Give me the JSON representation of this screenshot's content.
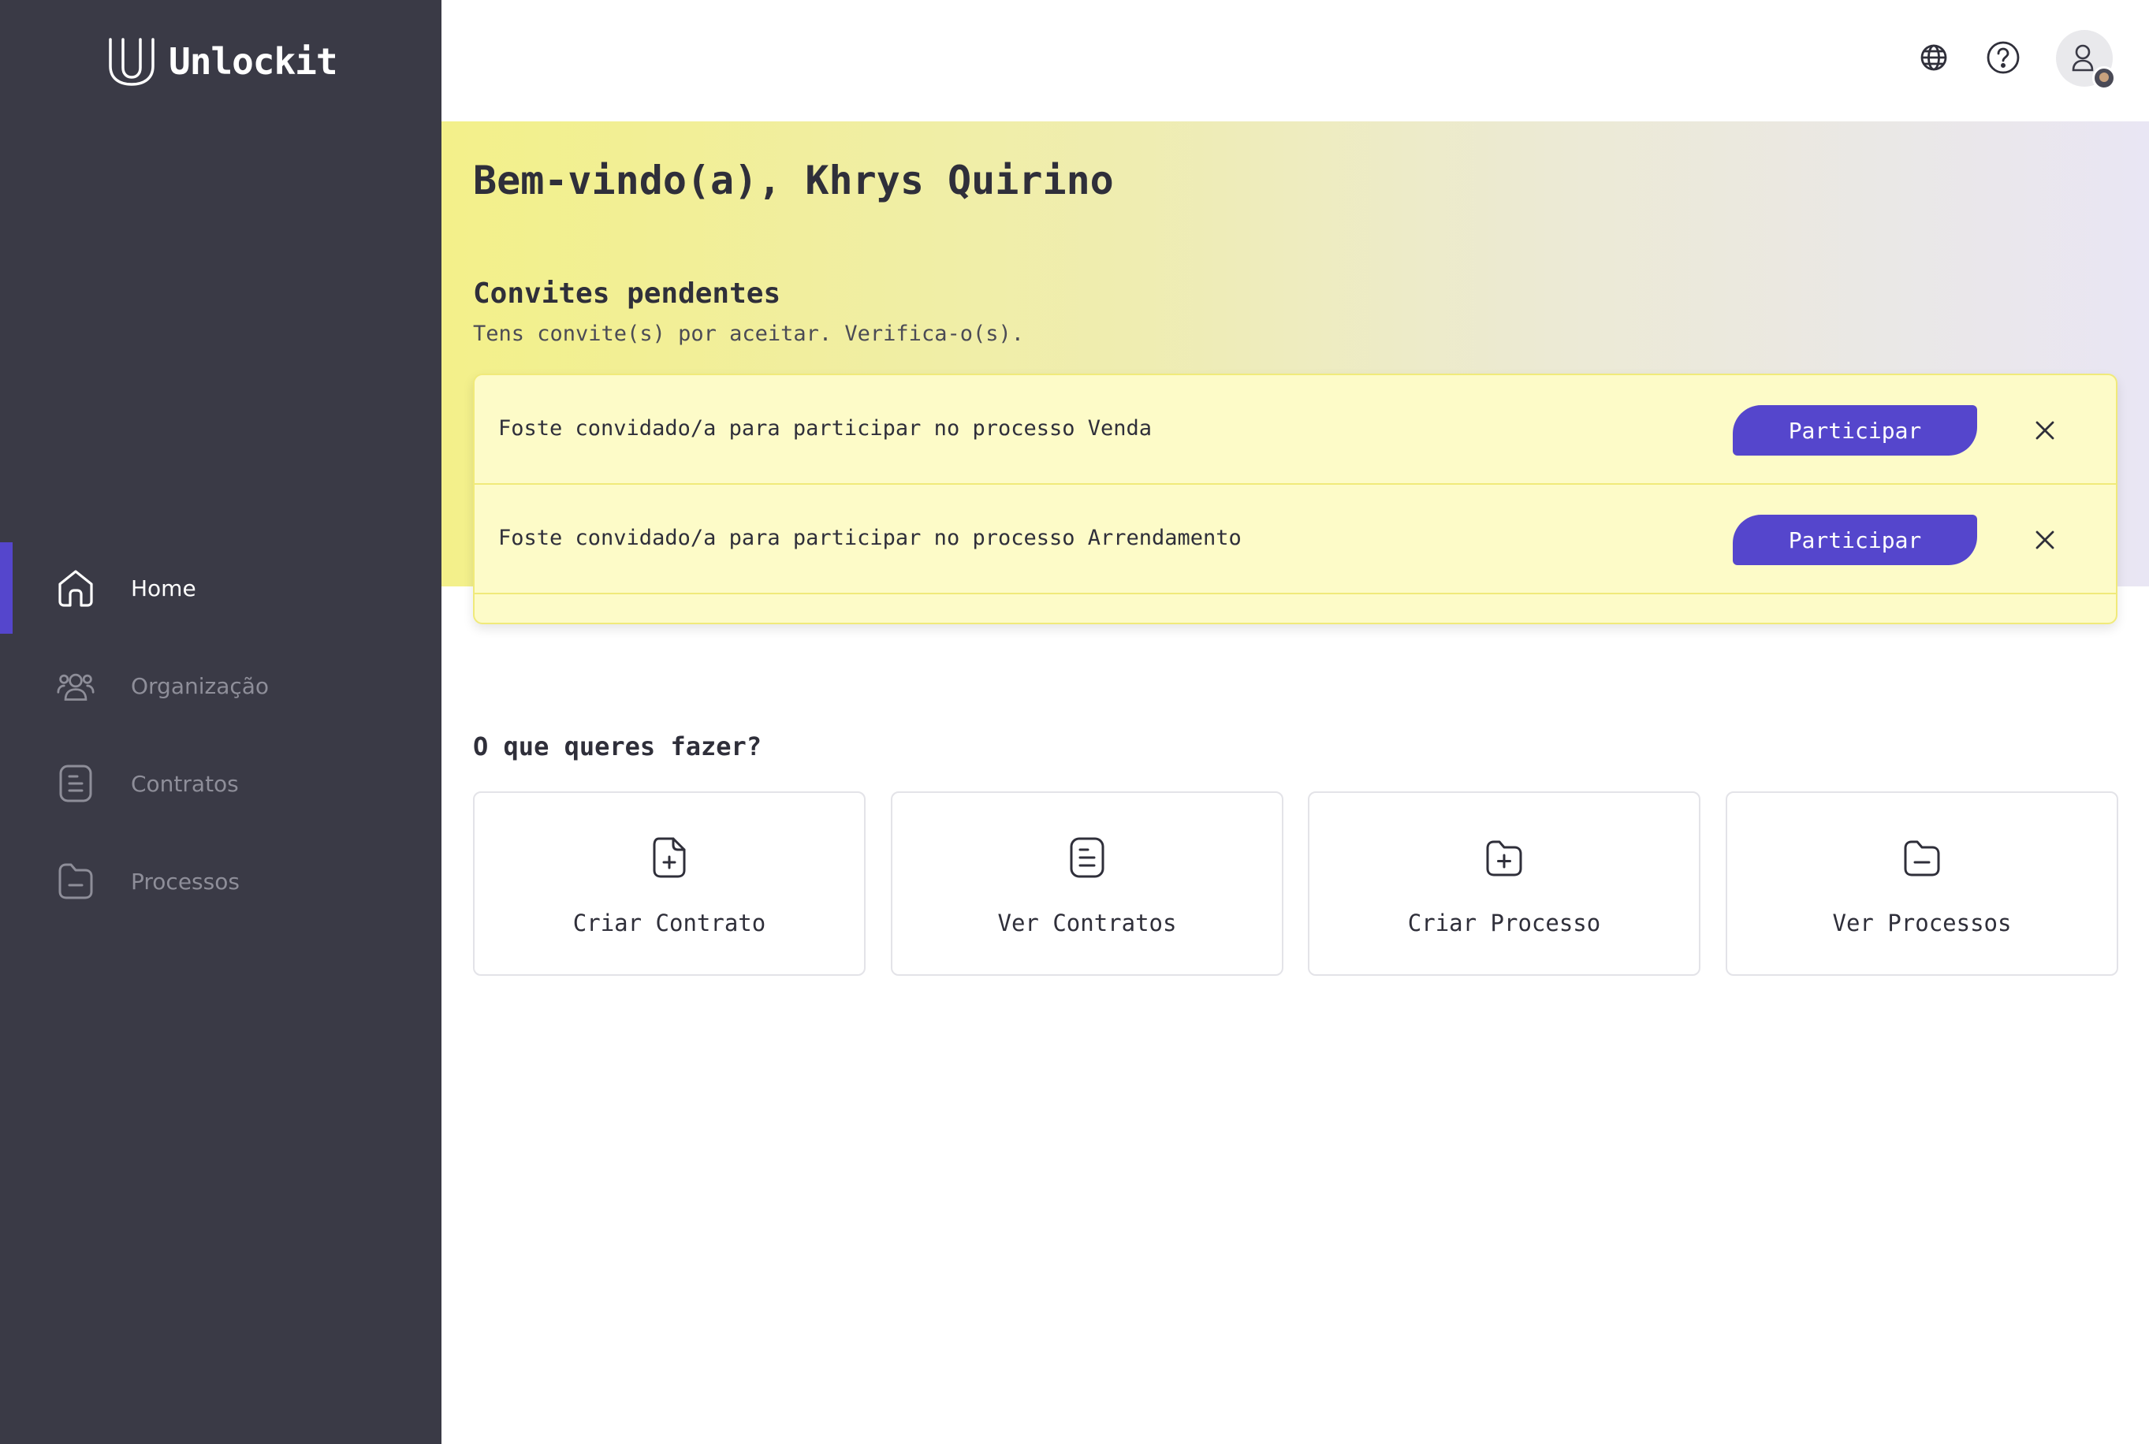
{
  "app": {
    "name": "Unlockit"
  },
  "sidebar": {
    "items": [
      {
        "label": "Home",
        "icon": "home-icon",
        "active": true
      },
      {
        "label": "Organização",
        "icon": "users-icon",
        "active": false
      },
      {
        "label": "Contratos",
        "icon": "document-icon",
        "active": false
      },
      {
        "label": "Processos",
        "icon": "folder-icon",
        "active": false
      }
    ]
  },
  "topbar": {
    "icons": [
      "globe-icon",
      "help-icon",
      "user-avatar"
    ]
  },
  "hero": {
    "welcome": "Bem-vindo(a), Khrys Quirino",
    "pending_title": "Convites pendentes",
    "pending_subtitle": "Tens convite(s) por aceitar. Verifica-o(s)."
  },
  "invites": [
    {
      "text": "Foste convidado/a para participar no processo Venda",
      "button": "Participar"
    },
    {
      "text": "Foste convidado/a para participar no processo Arrendamento",
      "button": "Participar"
    }
  ],
  "actions": {
    "title": "O que queres fazer?",
    "cards": [
      {
        "label": "Criar Contrato",
        "icon": "file-plus-icon"
      },
      {
        "label": "Ver Contratos",
        "icon": "document-icon"
      },
      {
        "label": "Criar Processo",
        "icon": "folder-plus-icon"
      },
      {
        "label": "Ver Processos",
        "icon": "folder-minus-icon"
      }
    ]
  },
  "colors": {
    "sidebar": "#3a3a46",
    "accent": "#5546cc",
    "invite_bg": "#fdfbc8",
    "hero_start": "#f3f08a",
    "hero_end": "#e9e6f4"
  }
}
